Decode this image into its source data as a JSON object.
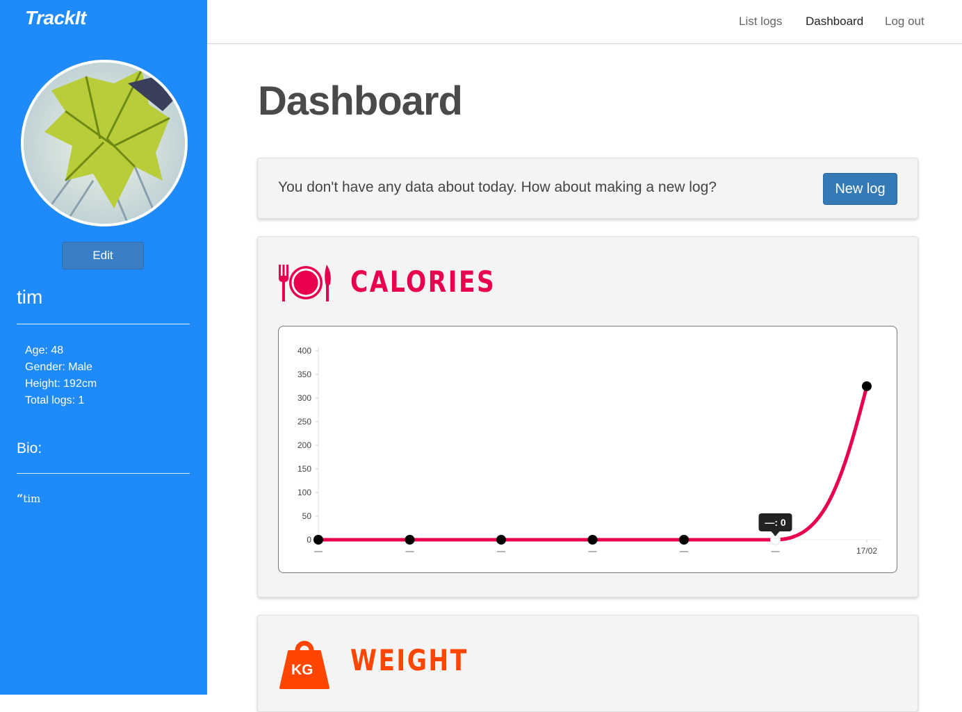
{
  "app": {
    "brand": "TrackIt"
  },
  "nav": {
    "list_logs": "List logs",
    "dashboard": "Dashboard",
    "log_out": "Log out"
  },
  "profile": {
    "edit_label": "Edit",
    "username": "tim",
    "age": "Age: 48",
    "gender": "Gender: Male",
    "height": "Height: 192cm",
    "total_logs": "Total logs: 1",
    "bio_heading": "Bio:",
    "bio_quote_mark": "“",
    "bio_text": "tim"
  },
  "main": {
    "title": "Dashboard",
    "alert_text": "You don't have any data about today. How about making a new log?",
    "new_log_label": "New log"
  },
  "calories": {
    "title": "CALORIES",
    "color": "#e8004f"
  },
  "weight": {
    "title": "WEIGHT",
    "color": "#ff4500",
    "icon_label": "KG"
  },
  "tooltip": "—: 0",
  "chart_data": {
    "type": "line",
    "categories": [
      "—",
      "—",
      "—",
      "—",
      "—",
      "—",
      "17/02"
    ],
    "series": [
      {
        "values": [
          0,
          0,
          0,
          0,
          0,
          0,
          325
        ]
      }
    ],
    "yticks": [
      0,
      50,
      100,
      150,
      200,
      250,
      300,
      350,
      400
    ],
    "ylim": [
      0,
      400
    ],
    "line_color": "#e8004f",
    "point_color": "#000000",
    "grid": false
  }
}
